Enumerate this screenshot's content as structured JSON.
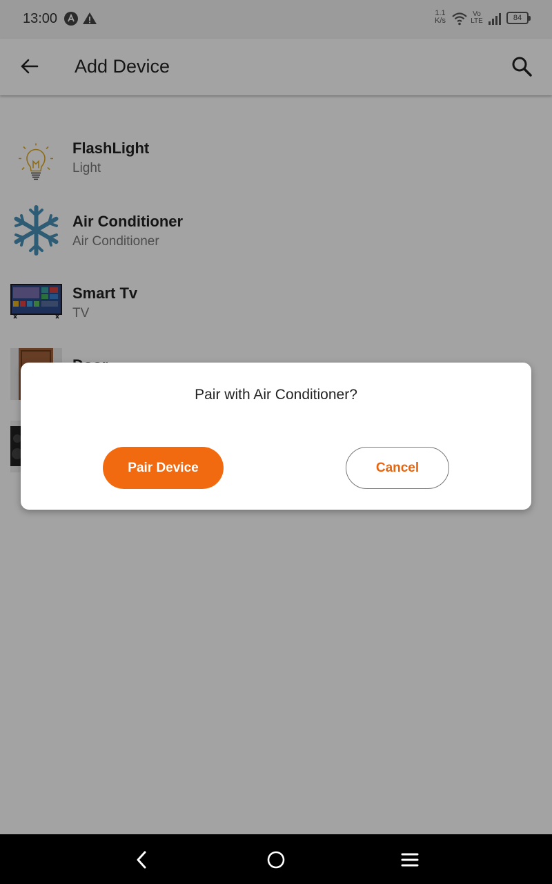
{
  "status_bar": {
    "time": "13:00",
    "speed_top": "1.1",
    "speed_bottom": "K/s",
    "volte_top": "Vo",
    "volte_bottom": "LTE",
    "battery": "84"
  },
  "app_bar": {
    "title": "Add Device",
    "back_icon": "arrow-left-icon",
    "search_icon": "search-icon"
  },
  "devices": [
    {
      "name": "FlashLight",
      "type": "Light",
      "icon": "bulb-icon"
    },
    {
      "name": "Air Conditioner",
      "type": "Air Conditioner",
      "icon": "snowflake-icon"
    },
    {
      "name": "Smart Tv",
      "type": "TV",
      "icon": "tv-icon"
    },
    {
      "name": "Door",
      "type": "",
      "icon": "door-icon"
    },
    {
      "name": "",
      "type": "",
      "icon": "speaker-icon"
    }
  ],
  "dialog": {
    "message": "Pair with Air Conditioner?",
    "confirm_label": "Pair Device",
    "cancel_label": "Cancel"
  },
  "colors": {
    "accent": "#f26a10",
    "snowflake": "#4a90b8",
    "bulb": "#e0a820"
  }
}
